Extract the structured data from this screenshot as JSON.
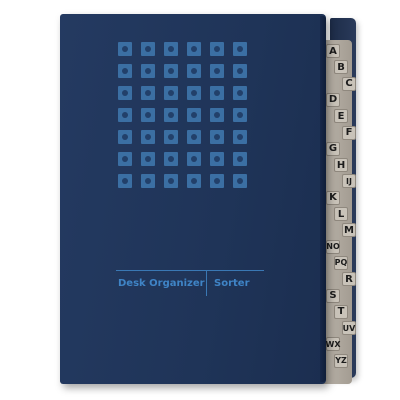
{
  "product": {
    "cover_label_left": "Desk Organizer",
    "cover_label_right": "Sorter",
    "cover_color": "#1f3458",
    "accent_color": "#3f84c6",
    "tab_color": "#c9c3b9"
  },
  "tabs": [
    "A",
    "B",
    "C",
    "D",
    "E",
    "F",
    "G",
    "H",
    "IJ",
    "K",
    "L",
    "M",
    "NO",
    "PQ",
    "R",
    "S",
    "T",
    "UV",
    "WX",
    "YZ"
  ]
}
